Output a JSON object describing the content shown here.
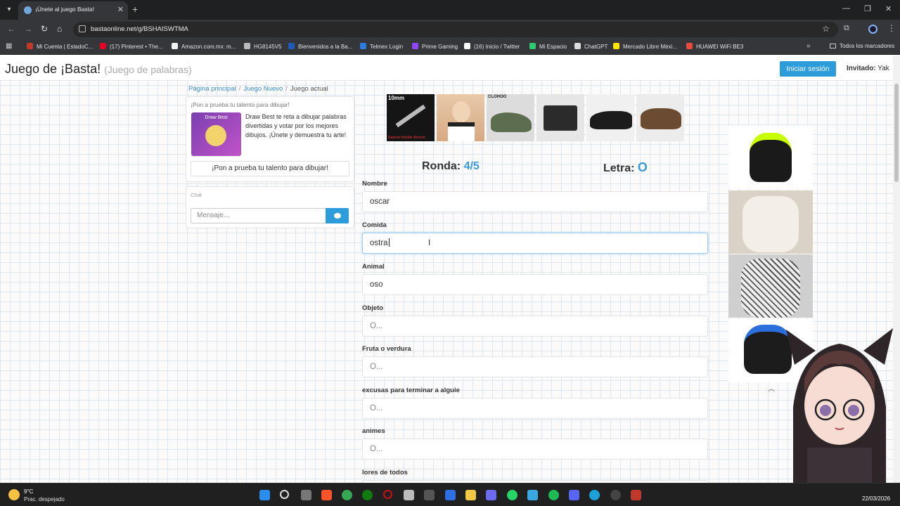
{
  "browser": {
    "tab_title": "¡Únete al juego Basta!",
    "new_tab_glyph": "+",
    "url": "bastaonline.net/g/BSHAISWTMA",
    "bookmarks": [
      {
        "label": "Mi Cuenta | EstadoC...",
        "color": "#c0392b"
      },
      {
        "label": "(17) Pinterest • The...",
        "color": "#e60023"
      },
      {
        "label": "Amazon.com.mx: m...",
        "color": "#f2f2f2"
      },
      {
        "label": "HG8145V5",
        "color": "#bbbbbb"
      },
      {
        "label": "Bienvenidos a la Ba...",
        "color": "#1e5bb8"
      },
      {
        "label": "Telmex Login",
        "color": "#2a7de1"
      },
      {
        "label": "Prime Gaming",
        "color": "#9146ff"
      },
      {
        "label": "(16) Inicio / Twitter",
        "color": "#ffffff"
      },
      {
        "label": "Mi Espacio",
        "color": "#2ecc71"
      },
      {
        "label": "ChatGPT",
        "color": "#dddddd"
      },
      {
        "label": "Mercado Libre Méxi...",
        "color": "#ffe600"
      },
      {
        "label": "HUAWEI WiFi BE3",
        "color": "#e74c3c"
      }
    ],
    "all_bookmarks": "Todos los marcadores"
  },
  "header": {
    "title": "Juego de ¡Basta!",
    "subtitle": "(Juego de palabras)",
    "login_label": "Iniciar sesión",
    "guest_label": "Invitado:",
    "guest_name": "Yak"
  },
  "breadcrumb": {
    "home": "Página principal",
    "new_game": "Juego Nuevo",
    "current": "Juego actual"
  },
  "promo": {
    "heading": "¡Pon a prueba tu talento para dibujar!",
    "image_title": "Draw Best",
    "text": "Draw Best te reta a dibujar palabras divertidas y votar por los mejores dibujos. ¡Únete y demuestra tu arte!",
    "button_label": "¡Pon a prueba tu talento para dibujar!"
  },
  "chat": {
    "label": "Chat",
    "placeholder": "Mensaje..."
  },
  "ads": {
    "strip_first_label": "Ratchet Handle Wrench",
    "strip_first_top": "10mm",
    "strip_third_top": "CLOHOO"
  },
  "game": {
    "round_label": "Ronda:",
    "round_value": "4/5",
    "letter_label": "Letra:",
    "letter_value": "O",
    "fields": [
      {
        "label": "Nombre",
        "value": "oscar"
      },
      {
        "label": "Comida",
        "value": "ostra"
      },
      {
        "label": "Animal",
        "value": "oso"
      },
      {
        "label": "Objeto",
        "value": "O..."
      },
      {
        "label": "Fruta o verdura",
        "value": "O..."
      },
      {
        "label": "excusas para terminar a alguie",
        "value": "O..."
      },
      {
        "label": "animes",
        "value": "O..."
      },
      {
        "label": "lores de todos",
        "value": ""
      }
    ]
  },
  "taskbar": {
    "temperature": "9°C",
    "weather": "Prac. despejado",
    "date": "22/03/2026"
  },
  "colors": {
    "accent": "#2d9cdb",
    "status_value": "#3a9ad9"
  }
}
